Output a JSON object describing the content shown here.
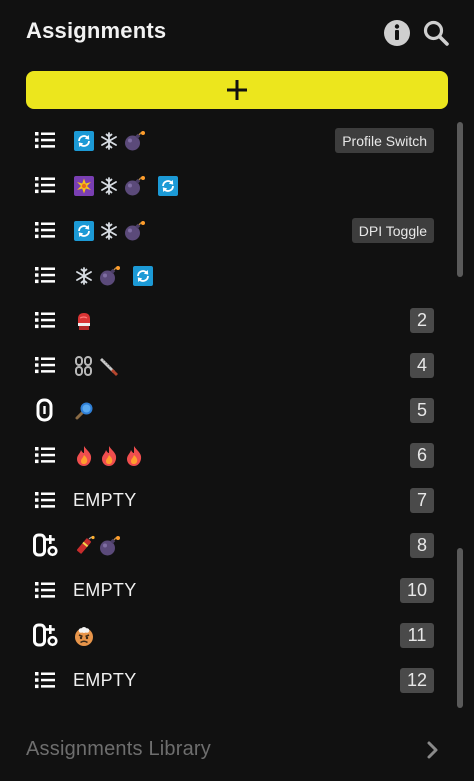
{
  "header": {
    "title": "Assignments",
    "info_icon": "info-icon",
    "search_icon": "search-icon"
  },
  "add_button": {
    "icon": "plus-icon",
    "color": "#ece61d"
  },
  "rows": [
    {
      "icon": "list-icon",
      "glyphs": [
        "refresh-badge-icon",
        "snowflake-icon",
        "bomb-icon"
      ],
      "label": "Profile Switch"
    },
    {
      "icon": "list-icon",
      "glyphs": [
        "starburst-badge-icon",
        "snowflake-icon",
        "bomb-icon",
        "refresh-badge-icon"
      ]
    },
    {
      "icon": "list-icon",
      "glyphs": [
        "refresh-badge-icon",
        "snowflake-icon",
        "bomb-icon"
      ],
      "label": "DPI Toggle"
    },
    {
      "icon": "list-icon",
      "glyphs": [
        "snowflake-icon",
        "bomb-icon",
        "refresh-badge-icon"
      ]
    },
    {
      "icon": "list-icon",
      "glyphs": [
        "boxing-glove-icon"
      ],
      "number": "2"
    },
    {
      "icon": "list-icon",
      "glyphs": [
        "chains-icon",
        "hacksaw-icon"
      ],
      "number": "4"
    },
    {
      "icon": "zero-icon",
      "glyphs": [
        "magnifier-icon"
      ],
      "number": "5"
    },
    {
      "icon": "list-icon",
      "glyphs": [
        "fire-icon",
        "fire-icon",
        "fire-icon"
      ],
      "number": "6"
    },
    {
      "icon": "list-icon",
      "text": "EMPTY",
      "number": "7"
    },
    {
      "icon": "zero-plus-icon",
      "glyphs": [
        "firecracker-icon",
        "bomb-icon"
      ],
      "number": "8"
    },
    {
      "icon": "list-icon",
      "text": "EMPTY",
      "number": "10"
    },
    {
      "icon": "zero-plus-icon",
      "glyphs": [
        "angry-face-icon"
      ],
      "number": "11"
    },
    {
      "icon": "list-icon",
      "text": "EMPTY",
      "number": "12"
    }
  ],
  "footer": {
    "label": "Assignments Library",
    "icon": "chevron-right-icon"
  }
}
